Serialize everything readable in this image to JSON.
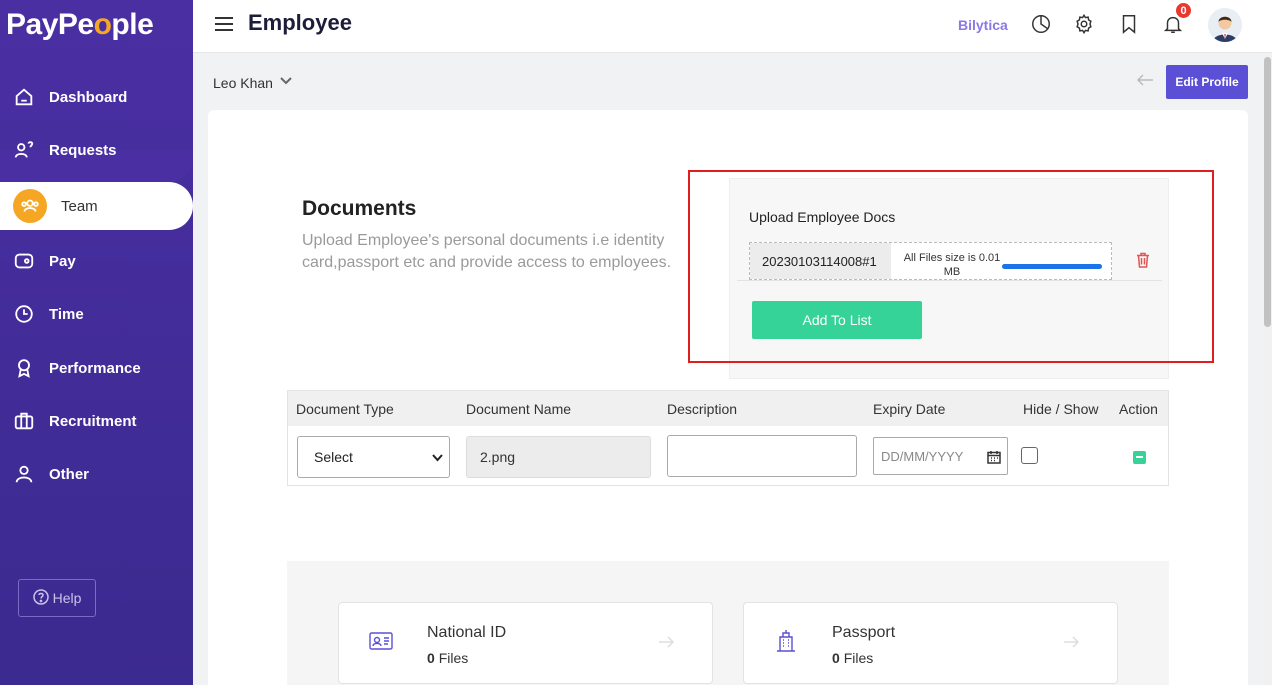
{
  "sidebar": {
    "logo_pre": "PayPe",
    "logo_dot": "o",
    "logo_post": "ple",
    "items": [
      {
        "label": "Dashboard",
        "icon": "home-icon"
      },
      {
        "label": "Requests",
        "icon": "requests-icon"
      },
      {
        "label": "Team",
        "icon": "team-icon",
        "active": true
      },
      {
        "label": "Pay",
        "icon": "wallet-icon"
      },
      {
        "label": "Time",
        "icon": "clock-icon"
      },
      {
        "label": "Performance",
        "icon": "award-icon"
      },
      {
        "label": "Recruitment",
        "icon": "briefcase-icon"
      },
      {
        "label": "Other",
        "icon": "user-icon"
      }
    ],
    "help_label": "Help"
  },
  "header": {
    "title": "Employee",
    "brand_link": "Bilytica",
    "notification_count": "0"
  },
  "subbar": {
    "employee_name": "Leo Khan",
    "edit_profile_label": "Edit Profile"
  },
  "documents": {
    "title": "Documents",
    "description": "Upload Employee's personal documents i.e identity card,passport etc and provide access to employees."
  },
  "upload": {
    "label": "Upload Employee Docs",
    "file_name": "20230103114008#1",
    "file_size_text": "All Files size is 0.01 MB",
    "progress": 1.0,
    "add_button_label": "Add To List"
  },
  "table": {
    "headers": [
      "Document Type",
      "Document Name",
      "Description",
      "Expiry Date",
      "Hide / Show",
      "Action"
    ],
    "row": {
      "document_type": "Select",
      "document_name": "2.png",
      "description": "",
      "expiry_placeholder": "DD/MM/YYYY"
    }
  },
  "categories": [
    {
      "title": "National ID",
      "count": "0",
      "suffix": "Files",
      "icon": "id-card-icon"
    },
    {
      "title": "Passport",
      "count": "0",
      "suffix": "Files",
      "icon": "building-icon"
    }
  ],
  "colors": {
    "sidebar": "#4a2fa3",
    "accent": "#5b4fd6",
    "active_icon": "#f5a623",
    "success": "#36d399",
    "highlight_box": "#e01e1e"
  }
}
